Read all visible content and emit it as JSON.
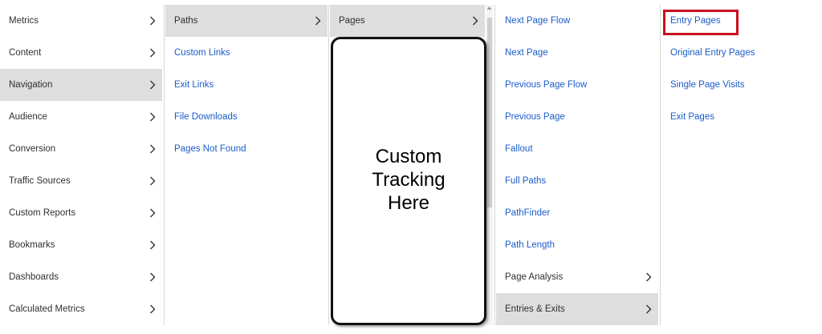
{
  "col1": {
    "items": [
      {
        "label": "Metrics",
        "selected": false
      },
      {
        "label": "Content",
        "selected": false
      },
      {
        "label": "Navigation",
        "selected": true
      },
      {
        "label": "Audience",
        "selected": false
      },
      {
        "label": "Conversion",
        "selected": false
      },
      {
        "label": "Traffic Sources",
        "selected": false
      },
      {
        "label": "Custom Reports",
        "selected": false
      },
      {
        "label": "Bookmarks",
        "selected": false
      },
      {
        "label": "Dashboards",
        "selected": false
      },
      {
        "label": "Calculated Metrics",
        "selected": false
      }
    ]
  },
  "col2": {
    "items": [
      {
        "label": "Paths",
        "selected": true,
        "submenu": true
      },
      {
        "label": "Custom Links",
        "selected": false,
        "submenu": false
      },
      {
        "label": "Exit Links",
        "selected": false,
        "submenu": false
      },
      {
        "label": "File Downloads",
        "selected": false,
        "submenu": false
      },
      {
        "label": "Pages Not Found",
        "selected": false,
        "submenu": false
      }
    ]
  },
  "col3": {
    "items": [
      {
        "label": "Pages",
        "selected": true,
        "submenu": true
      }
    ]
  },
  "col4": {
    "items": [
      {
        "label": "Next Page Flow",
        "selected": false,
        "submenu": false
      },
      {
        "label": "Next Page",
        "selected": false,
        "submenu": false
      },
      {
        "label": "Previous Page Flow",
        "selected": false,
        "submenu": false
      },
      {
        "label": "Previous Page",
        "selected": false,
        "submenu": false
      },
      {
        "label": "Fallout",
        "selected": false,
        "submenu": false
      },
      {
        "label": "Full Paths",
        "selected": false,
        "submenu": false
      },
      {
        "label": "PathFinder",
        "selected": false,
        "submenu": false
      },
      {
        "label": "Path Length",
        "selected": false,
        "submenu": false
      },
      {
        "label": "Page Analysis",
        "selected": false,
        "submenu": true
      },
      {
        "label": "Entries & Exits",
        "selected": true,
        "submenu": true
      }
    ]
  },
  "col5": {
    "items": [
      {
        "label": "Entry Pages",
        "highlighted": true
      },
      {
        "label": "Original Entry Pages",
        "highlighted": false
      },
      {
        "label": "Single Page Visits",
        "highlighted": false
      },
      {
        "label": "Exit Pages",
        "highlighted": false
      }
    ]
  },
  "annotation": {
    "text_lines": [
      "Custom",
      "Tracking",
      "Here"
    ]
  },
  "colors": {
    "link": "#1a5cc8",
    "selected_bg": "#dedede",
    "highlight_border": "#c8101d"
  },
  "icons": {
    "submenu": "chevron-right-icon",
    "scroll_up": "scroll-up-arrow-icon"
  }
}
